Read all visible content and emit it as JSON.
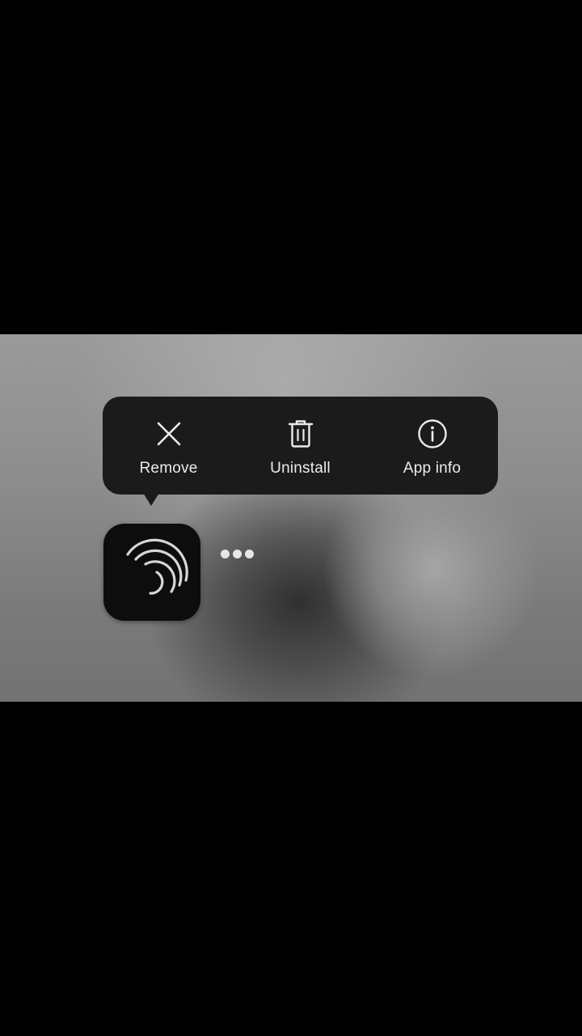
{
  "popup": {
    "actions": [
      {
        "id": "remove",
        "label": "Remove",
        "icon": "close-icon"
      },
      {
        "id": "uninstall",
        "label": "Uninstall",
        "icon": "trash-icon"
      },
      {
        "id": "app-info",
        "label": "App info",
        "icon": "info-icon"
      }
    ]
  },
  "app": {
    "icon": "alight-motion-logo-icon"
  },
  "colors": {
    "popup_bg": "#1b1b1b",
    "label_text": "#ececec",
    "app_icon_bg": "#0d0d0d"
  }
}
